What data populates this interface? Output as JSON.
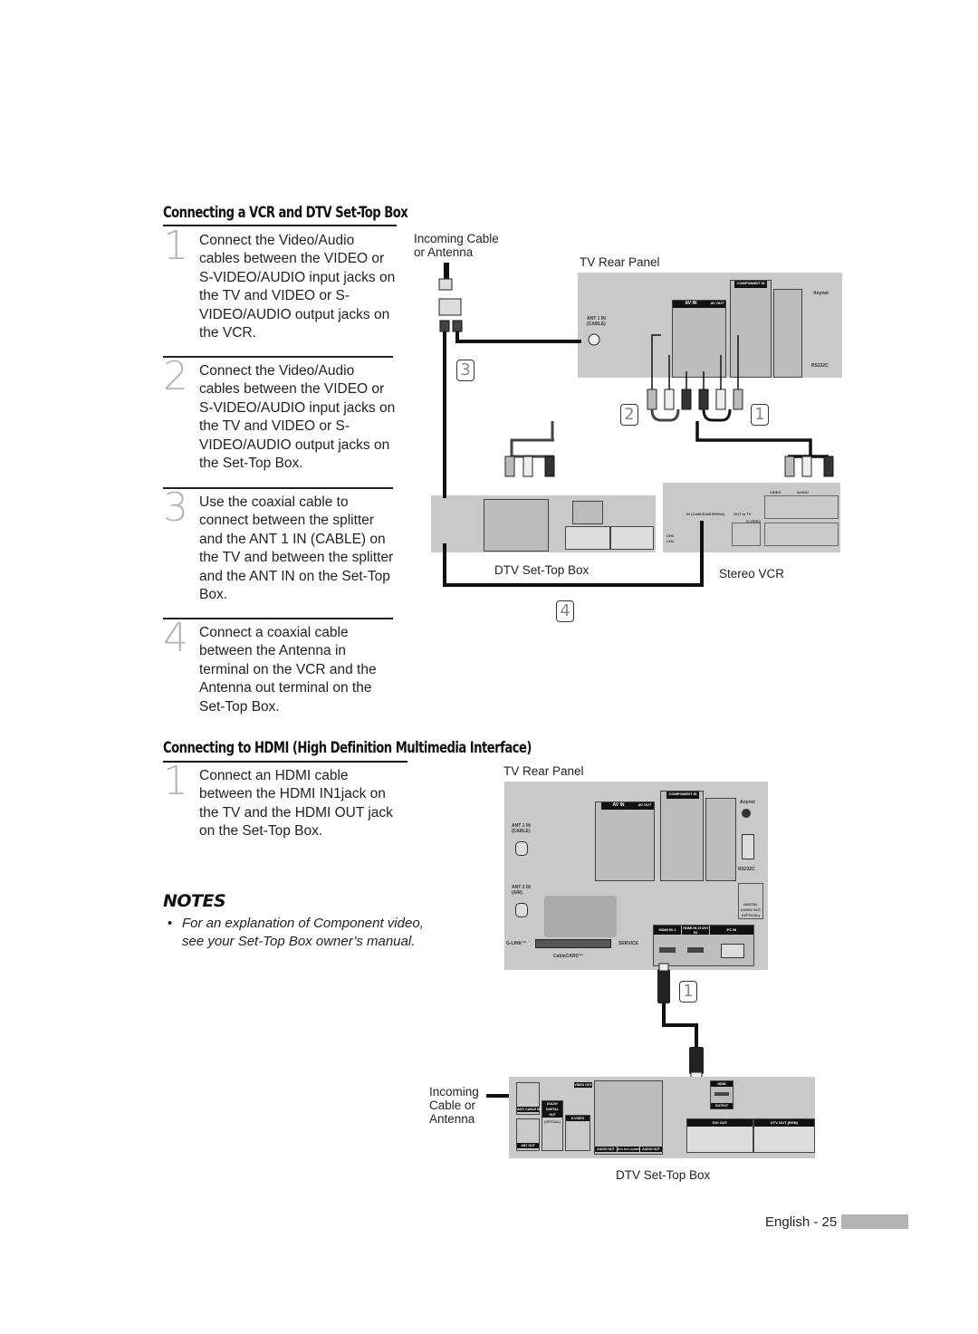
{
  "section1": {
    "title": "Connecting a VCR and DTV Set-Top Box",
    "steps": [
      {
        "num": "1",
        "text": "Connect the Video/Audio cables between the VIDEO or S-VIDEO/AUDIO input jacks on the TV and VIDEO or S-VIDEO/AUDIO output jacks on the VCR."
      },
      {
        "num": "2",
        "text": "Connect the Video/Audio cables between the VIDEO or S-VIDEO/AUDIO input jacks on the TV and VIDEO or S-VIDEO/AUDIO output jacks on the Set-Top Box."
      },
      {
        "num": "3",
        "text": "Use the coaxial cable to connect between the splitter and the ANT 1 IN (CABLE) on the TV and between the splitter and the ANT IN on the Set-Top Box."
      },
      {
        "num": "4",
        "text": "Connect a coaxial cable between the Antenna in terminal on the VCR and the Antenna out terminal on the Set-Top Box."
      }
    ],
    "diagram": {
      "incoming_label_line1": "Incoming Cable",
      "incoming_label_line2": "or Antenna",
      "splitter_label": "Splitter",
      "tv_panel_label": "TV Rear Panel",
      "ant1_label_line1": "ANT 1 IN",
      "ant1_label_line2": "(CABLE)",
      "av_in_label": "AV IN",
      "av_out_label": "AV OUT",
      "component_in_label": "COMPONENT IN",
      "anynet_label": "Anynet",
      "rs232c_label": "RS232C",
      "stb_label": "DTV Set-Top Box",
      "vcr_label": "Stereo VCR",
      "vcr_in_label": "IN (CABLE/ANTENNA)",
      "vcr_out_label": "OUT to TV",
      "vcr_svideo_label": "S-VIDEO",
      "vcr_video_label": "VIDEO",
      "vcr_audio_label": "AUDIO",
      "vcr_ch3": "CH3",
      "vcr_ch4": "CH4",
      "badges": {
        "b1": "1",
        "b2": "2",
        "b3": "3",
        "b4": "4"
      }
    }
  },
  "section2": {
    "title": "Connecting to HDMI (High Definition Multimedia Interface)",
    "steps": [
      {
        "num": "1",
        "text": "Connect an HDMI cable between the HDMI IN1jack on the TV and the HDMI OUT jack on the Set-Top Box."
      }
    ],
    "diagram": {
      "tv_panel_label": "TV Rear Panel",
      "ant1_label_line1": "ANT 1 IN",
      "ant1_label_line2": "(CABLE)",
      "ant2_label_line1": "ANT 2 IN",
      "ant2_label_line2": "(AIR)",
      "av_in_label": "AV IN",
      "av_out_label": "AV OUT",
      "component_in_label": "COMPONENT IN",
      "anynet_label": "Anynet",
      "rs232c_label": "RS232C",
      "digital_audio_label": "DIGITAL AUDIO OUT (OPTICAL)",
      "glink_label": "G-LINK™",
      "cablecard_label": "CableCARD™",
      "service_label": "SERVICE",
      "hdmi_in1_label": "HDMI IN 1",
      "hdmi_in2_label": "HDMI IN 2/ DVI IN",
      "pc_in_label": "PC IN",
      "incoming_line1": "Incoming",
      "incoming_line2": "Cable or",
      "incoming_line3": "Antenna",
      "stb_label": "DTV Set-Top Box",
      "stb_ant_in": "ANT/ CABLE IN",
      "stb_ant_out": "ANT OUT",
      "stb_dolby": "DOLBY DIGITAL OUT",
      "stb_optical": "(OPTICAL)",
      "stb_svideo": "S-VIDEO",
      "stb_video_out": "VIDEO OUT",
      "stb_audio_out": "AUDIO OUT",
      "stb_dtv_out": "DTV OUT COMPONENT",
      "stb_hdmi": "HDMI",
      "stb_output": "OUTPUT",
      "stb_dvi_out": "DVI OUT",
      "stb_rgb_out": "DTV OUT (RGB)",
      "badge": "1"
    }
  },
  "notes": {
    "title": "NOTES",
    "items": [
      "For an explanation of Component video, see your Set-Top Box owner’s manual."
    ]
  },
  "footer": {
    "page_label": "English - 25"
  }
}
